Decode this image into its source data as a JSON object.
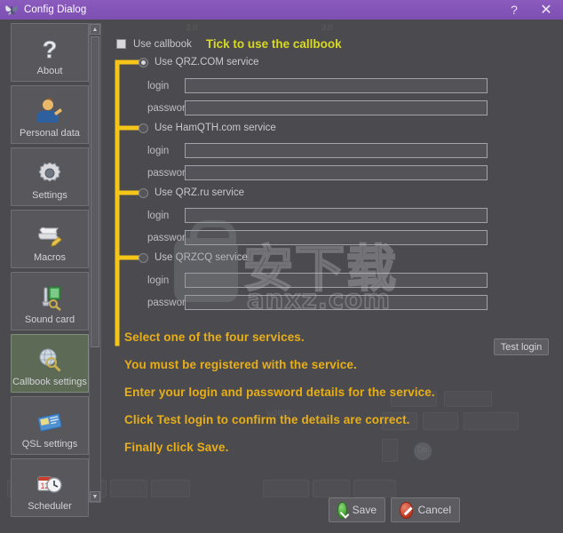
{
  "window": {
    "title": "Config Dialog",
    "icon": "butterfly-icon",
    "help_label": "?",
    "close_label": "✕",
    "titlebar_color": "#8455b8"
  },
  "sidebar": {
    "items": [
      {
        "label": "About",
        "icon": "question-mark-icon",
        "selected": false
      },
      {
        "label": "Personal data",
        "icon": "person-icon",
        "selected": false
      },
      {
        "label": "Settings",
        "icon": "gear-icon",
        "selected": false
      },
      {
        "label": "Macros",
        "icon": "scroll-pencil-icon",
        "selected": false
      },
      {
        "label": "Sound card",
        "icon": "microphone-icon",
        "selected": false
      },
      {
        "label": "Callbook settings",
        "icon": "globe-search-icon",
        "selected": true
      },
      {
        "label": "QSL settings",
        "icon": "qsl-card-icon",
        "selected": false
      },
      {
        "label": "Scheduler",
        "icon": "calendar-clock-icon",
        "selected": false
      }
    ],
    "scrollbar": {
      "up_arrow": "▲",
      "down_arrow": "▼"
    }
  },
  "main": {
    "use_callbook": {
      "label": "Use callbook",
      "checked": false,
      "note": "Tick to use the callbook",
      "note_color": "#d9d924"
    },
    "services": [
      {
        "name": "Use QRZ.COM service",
        "selected": true,
        "login_label": "login",
        "login_value": "",
        "password_label": "password",
        "password_value": ""
      },
      {
        "name": "Use HamQTH.com service",
        "selected": false,
        "login_label": "login",
        "login_value": "",
        "password_label": "password",
        "password_value": ""
      },
      {
        "name": "Use QRZ.ru service",
        "selected": false,
        "login_label": "login",
        "login_value": "",
        "password_label": "password",
        "password_value": ""
      },
      {
        "name": "Use QRZCQ service",
        "selected": false,
        "login_label": "login",
        "login_value": "",
        "password_label": "password",
        "password_value": ""
      }
    ],
    "test_login_label": "Test login",
    "instructions": [
      "Select one of the four services.",
      "You must be registered with the service.",
      "Enter your login and password details for the service.",
      "Click Test login to confirm the details are correct.",
      "Finally click Save."
    ],
    "instruction_color": "#e8ae17",
    "annotation_color": "#f5c518"
  },
  "footer": {
    "save_label": "Save",
    "cancel_label": "Cancel"
  },
  "watermark": {
    "text_cn": "安下载",
    "text_url": "anxz.com",
    "icon": "shield-lock-icon"
  }
}
